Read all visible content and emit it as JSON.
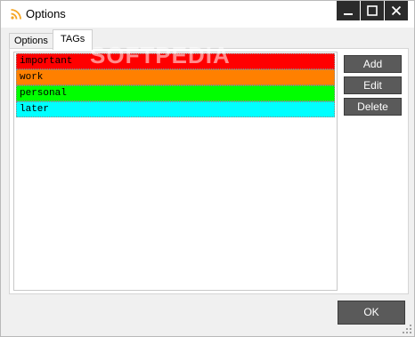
{
  "window": {
    "title": "Options",
    "controls": {
      "minimize_icon": "minimize-icon",
      "maximize_icon": "maximize-icon",
      "close_icon": "close-icon"
    }
  },
  "tabs": [
    {
      "label": "Options",
      "active": false
    },
    {
      "label": "TAGs",
      "active": true
    }
  ],
  "tags": [
    {
      "name": "important",
      "color": "#ff0000"
    },
    {
      "name": "work",
      "color": "#ff8000"
    },
    {
      "name": "personal",
      "color": "#00ff00"
    },
    {
      "name": "later",
      "color": "#00ffff"
    }
  ],
  "buttons": {
    "add": "Add",
    "edit": "Edit",
    "delete": "Delete",
    "ok": "OK"
  },
  "watermark": "SOFTPEDIA",
  "colors": {
    "button_bg": "#5a5a5a",
    "titlebar_controls": "#2b2b2b",
    "rss_icon": "#f5a623"
  }
}
